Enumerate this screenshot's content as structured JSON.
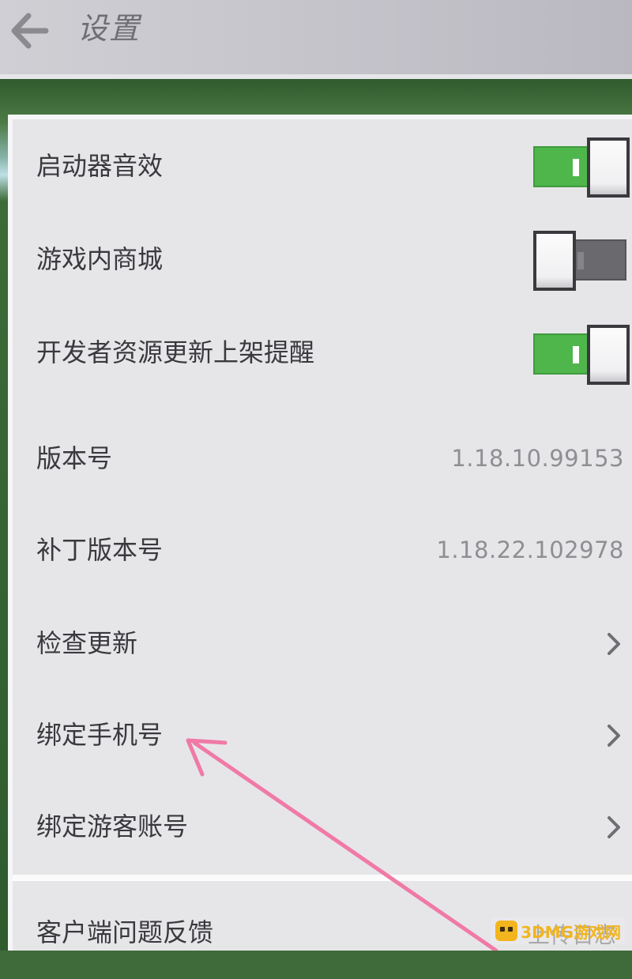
{
  "header": {
    "title": "设置"
  },
  "settings": {
    "rows": [
      {
        "label": "启动器音效",
        "type": "toggle",
        "state": "on"
      },
      {
        "label": "游戏内商城",
        "type": "toggle",
        "state": "off"
      },
      {
        "label": "开发者资源更新上架提醒",
        "type": "toggle",
        "state": "on"
      },
      {
        "label": "版本号",
        "type": "value",
        "value": "1.18.10.99153"
      },
      {
        "label": "补丁版本号",
        "type": "value",
        "value": "1.18.22.102978"
      },
      {
        "label": "检查更新",
        "type": "link"
      },
      {
        "label": "绑定手机号",
        "type": "link"
      },
      {
        "label": "绑定游客账号",
        "type": "link"
      }
    ],
    "bottom_row": {
      "label": "客户端问题反馈",
      "value": "上传日志"
    }
  },
  "annotation": {
    "color": "#f07aa6"
  },
  "watermark": {
    "text": "3DMG游戏网"
  },
  "colors": {
    "toggle_on": "#4fb64c",
    "toggle_off": "#6a6a6e",
    "panel_bg": "#e6e6e9",
    "text": "#3a3a3e",
    "value_text": "#8e8e93"
  }
}
